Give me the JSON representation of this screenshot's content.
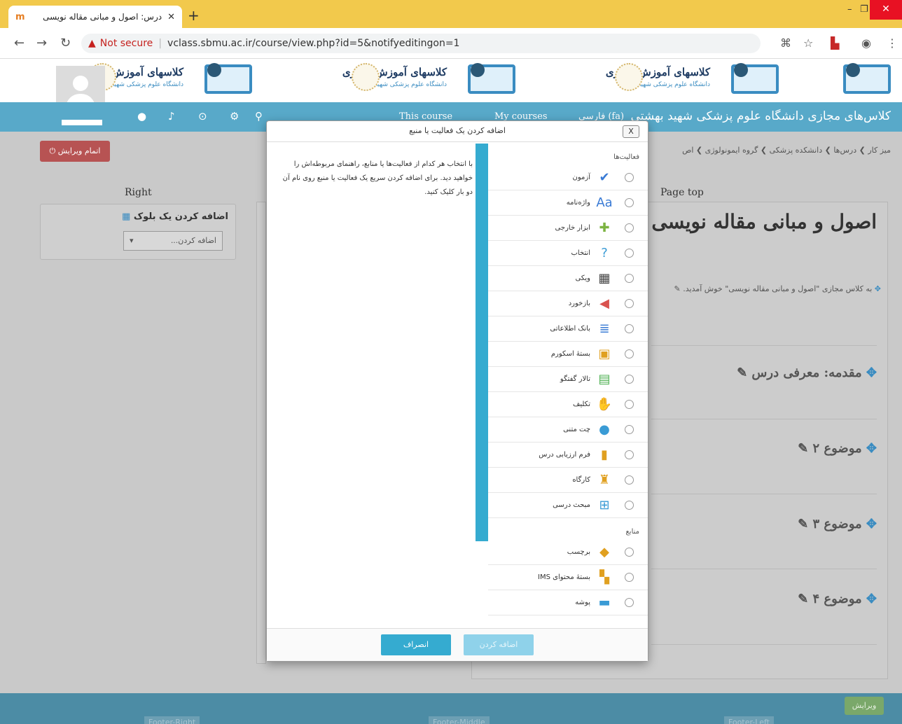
{
  "browser": {
    "tab_title": "درس: اصول و مبانی مقاله نویسی",
    "tab_favicon": "m",
    "new_tab": "+",
    "not_secure": "Not secure",
    "url": "vclass.sbmu.ac.ir/course/view.php?id=5&notifyeditingon=1"
  },
  "banner": {
    "title": "کلاسهای آموزش مجازی",
    "subtitle": "دانشگاه علوم پزشکی شهید بهشتی"
  },
  "menubar": {
    "site_title": "کلاس‌های مجازی دانشگاه علوم پزشکی شهید بهشتی",
    "language": "فارسی (fa)",
    "my_courses": "My courses",
    "this_course": "This course"
  },
  "page": {
    "finish_editing": "اتمام ویرایش",
    "right_label": "Right",
    "page_top": "Page top",
    "breadcrumb": "میز کار  ❯  درس‌ها  ❯  دانشکده پزشکی  ❯  گروه ایمونولوژی  ❯  اص",
    "course_title": "اصول و مبانی مقاله نویسی",
    "welcome": "به کلاس مجازی \"اصول و مبانی مقاله نویسی\" خوش آمدید.",
    "sections": [
      "مقدمه: معرفی درس",
      "موضوع ۲",
      "موضوع ۳",
      "موضوع ۴"
    ],
    "edit": "ویرایش"
  },
  "block": {
    "title": "اضافه کردن یک بلوک",
    "select_placeholder": "اضافه کردن..."
  },
  "footer": {
    "right": "Footer-Right",
    "middle": "Footer-Middle",
    "left": "Footer-Left"
  },
  "modal": {
    "title": "اضافه کردن یک فعالیت یا منبع",
    "close": "X",
    "help": "با انتخاب هر کدام از فعالیت‌ها یا منابع، راهنمای مربوطه‌اش را خواهید دید. برای اضافه کردن سریع یک فعالیت یا منبع روی نام آن دو بار کلیک کنید.",
    "activities_heading": "فعالیت‌ها",
    "resources_heading": "منابع",
    "activities": [
      {
        "label": "آزمون",
        "icon": "quiz-icon",
        "glyph": "✔",
        "color": "#3a7bd5"
      },
      {
        "label": "واژه‌نامه",
        "icon": "glossary-icon",
        "glyph": "Aa",
        "color": "#3a7bd5"
      },
      {
        "label": "ابزار خارجی",
        "icon": "puzzle-icon",
        "glyph": "✚",
        "color": "#7cb342"
      },
      {
        "label": "انتخاب",
        "icon": "question-icon",
        "glyph": "?",
        "color": "#3a9bd5"
      },
      {
        "label": "ویکی",
        "icon": "wiki-icon",
        "glyph": "▦",
        "color": "#444444"
      },
      {
        "label": "بازخورد",
        "icon": "megaphone-icon",
        "glyph": "◀",
        "color": "#d9534f"
      },
      {
        "label": "بانک اطلاعاتی",
        "icon": "database-icon",
        "glyph": "≣",
        "color": "#3a7bd5"
      },
      {
        "label": "بستهٔ اسکورم",
        "icon": "package-icon",
        "glyph": "▣",
        "color": "#e0a020"
      },
      {
        "label": "تالار گفتگو",
        "icon": "forum-icon",
        "glyph": "▤",
        "color": "#4caf50"
      },
      {
        "label": "تکلیف",
        "icon": "assignment-icon",
        "glyph": "✋",
        "color": "#e0a020"
      },
      {
        "label": "چت متنی",
        "icon": "chat-icon",
        "glyph": "●",
        "color": "#3a9bd5"
      },
      {
        "label": "فرم ارزیابی درس",
        "icon": "bar-chart-icon",
        "glyph": "▮",
        "color": "#e0a020"
      },
      {
        "label": "کارگاه",
        "icon": "workshop-icon",
        "glyph": "♜",
        "color": "#e0a020"
      },
      {
        "label": "مبحث درسی",
        "icon": "lesson-icon",
        "glyph": "⊞",
        "color": "#3a9bd5"
      }
    ],
    "resources": [
      {
        "label": "برچسب",
        "icon": "label-icon",
        "glyph": "◆",
        "color": "#e0a020"
      },
      {
        "label": "بستهٔ محتوای IMS",
        "icon": "ims-package-icon",
        "glyph": "▚",
        "color": "#e0a020"
      },
      {
        "label": "پوشه",
        "icon": "folder-icon",
        "glyph": "▬",
        "color": "#3a9bd5"
      }
    ],
    "add_button": "اضافه کردن",
    "cancel_button": "انصراف"
  }
}
